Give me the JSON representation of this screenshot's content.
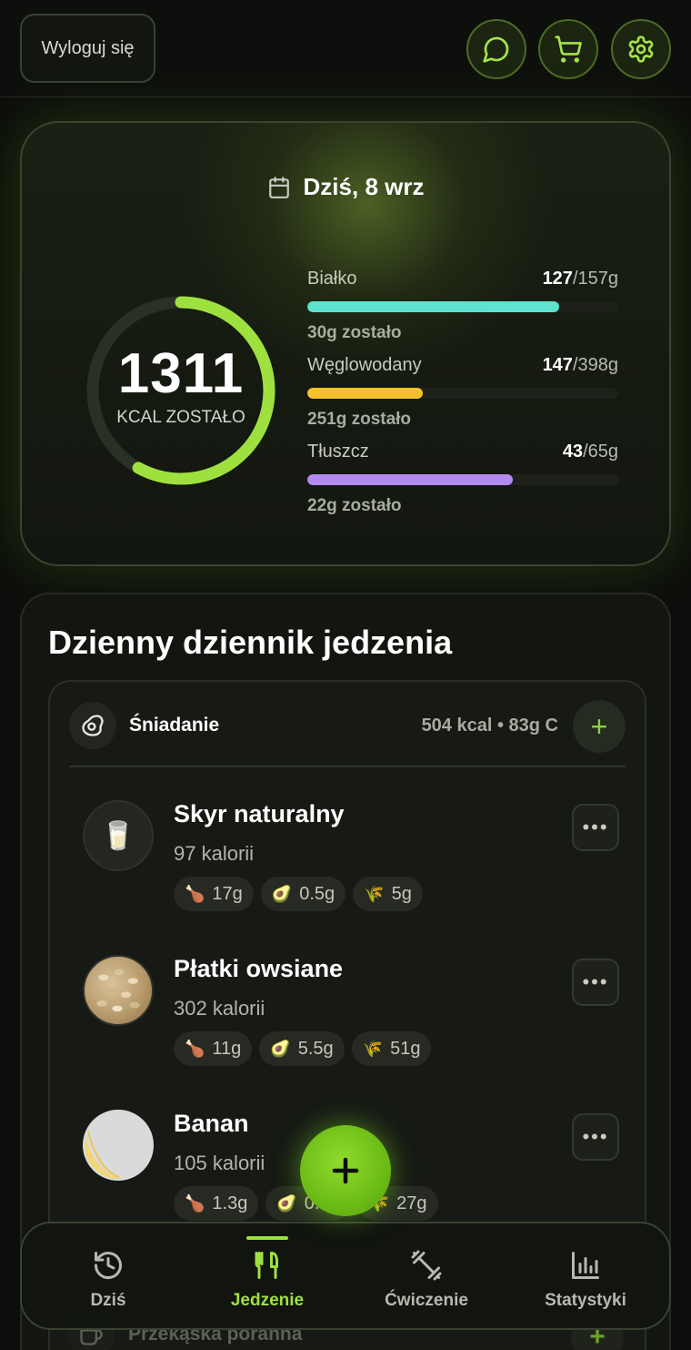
{
  "header": {
    "logout_label": "Wyloguj się",
    "icons": [
      "chat-icon",
      "cart-icon",
      "gear-icon"
    ]
  },
  "summary": {
    "date_label": "Dziś, 8 wrz",
    "kcal_left": "1311",
    "kcal_label": "KCAL ZOSTAŁO",
    "ring_progress": 0.58,
    "macros": [
      {
        "name": "Białko",
        "current": "127",
        "goal": "/157g",
        "left": "30g zostało",
        "fraction": 0.81,
        "color": "#5de3cf"
      },
      {
        "name": "Węglowodany",
        "current": "147",
        "goal": "/398g",
        "left": "251g zostało",
        "fraction": 0.37,
        "color": "#f6c12c"
      },
      {
        "name": "Tłuszcz",
        "current": "43",
        "goal": "/65g",
        "left": "22g zostało",
        "fraction": 0.66,
        "color": "#b28af0"
      }
    ]
  },
  "log": {
    "title": "Dzienny dziennik jedzenia",
    "meal": {
      "name": "Śniadanie",
      "summary": "504 kcal • 83g C",
      "add_label": "+"
    },
    "foods": [
      {
        "name": "Skyr naturalny",
        "kcal": "97 kalorii",
        "protein": "17g",
        "fat": "0.5g",
        "carbs": "5g",
        "thumb": "🥛"
      },
      {
        "name": "Płatki owsiane",
        "kcal": "302 kalorii",
        "protein": "11g",
        "fat": "5.5g",
        "carbs": "51g",
        "thumb": ""
      },
      {
        "name": "Banan",
        "kcal": "105 kalorii",
        "protein": "1.3g",
        "fat": "0.4g",
        "carbs": "27g",
        "thumb": ""
      }
    ],
    "next_meal": "Przekąska poranna"
  },
  "nav": {
    "items": [
      {
        "label": "Dziś"
      },
      {
        "label": "Jedzenie"
      },
      {
        "label": "Ćwiczenie"
      },
      {
        "label": "Statystyki"
      }
    ],
    "active": "Jedzenie"
  },
  "colors": {
    "accent": "#9ee13f",
    "ring": "#9ee13f",
    "background": "#0c0e0b"
  }
}
